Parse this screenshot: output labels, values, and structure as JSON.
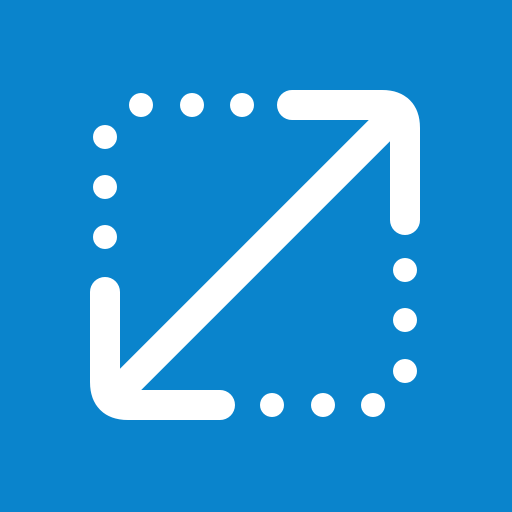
{
  "icon": {
    "name": "resize-diagonal-icon",
    "background_color": "#0a84cc",
    "glyph_color": "#ffffff"
  }
}
